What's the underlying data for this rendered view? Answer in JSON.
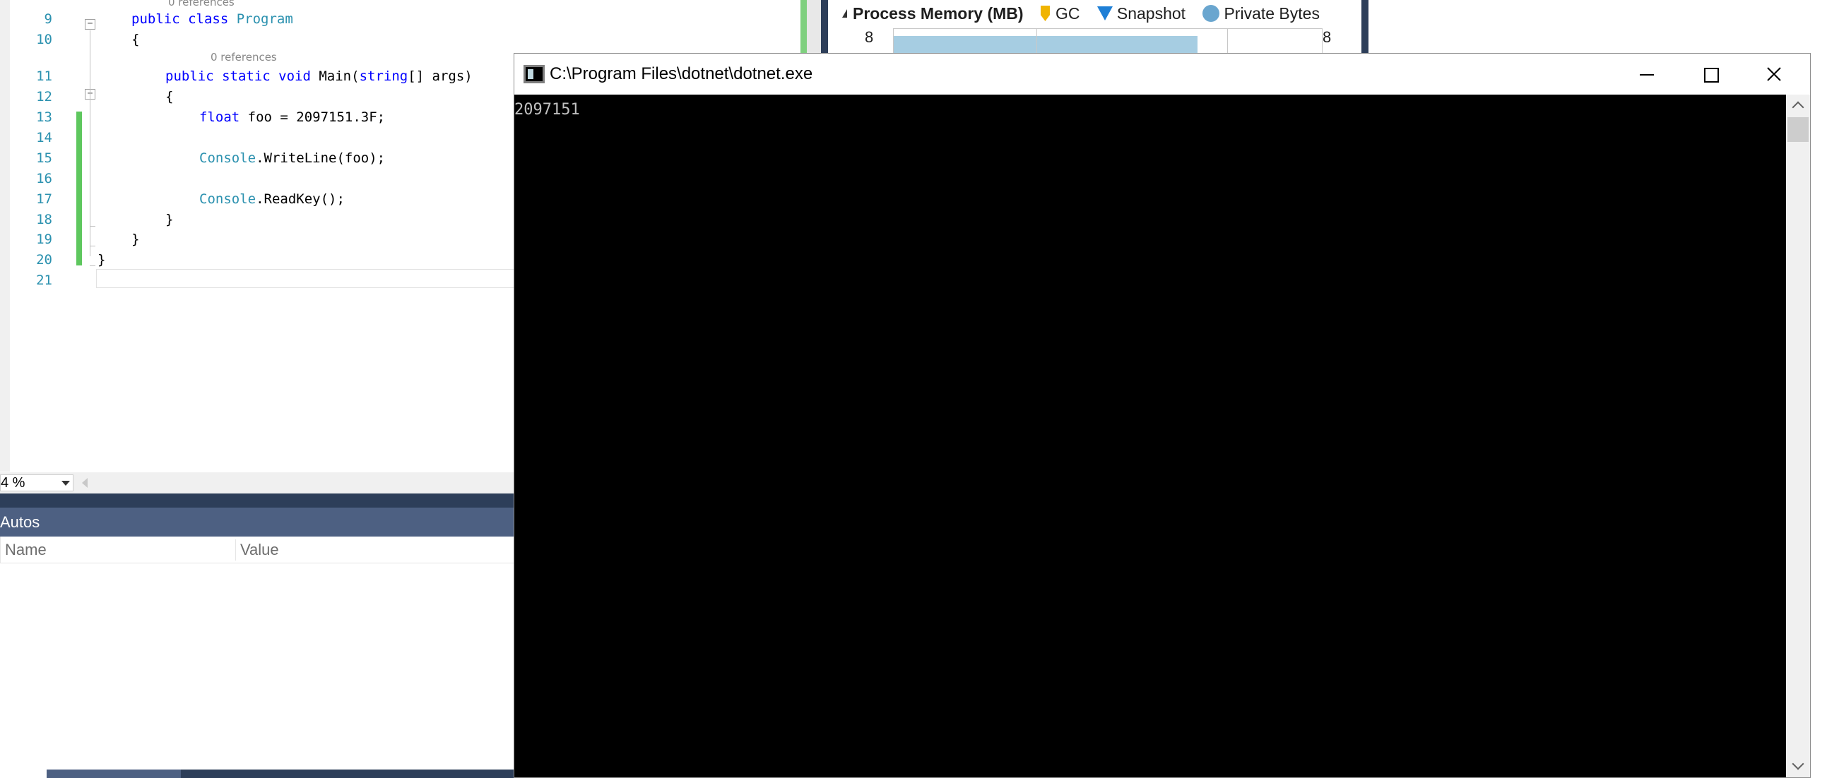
{
  "editor": {
    "code_lens_top": "0 references",
    "code_lens_main": "0 references",
    "lines": [
      {
        "num": "9",
        "tokens": [
          {
            "t": "public ",
            "c": "kw"
          },
          {
            "t": "class ",
            "c": "kw"
          },
          {
            "t": "Program",
            "c": "ty"
          }
        ]
      },
      {
        "num": "10",
        "tokens": [
          {
            "t": "{",
            "c": ""
          }
        ]
      },
      {
        "num": "11",
        "tokens": [
          {
            "t": "public ",
            "c": "kw"
          },
          {
            "t": "static ",
            "c": "kw"
          },
          {
            "t": "void ",
            "c": "kw"
          },
          {
            "t": "Main(",
            "c": ""
          },
          {
            "t": "string",
            "c": "kw"
          },
          {
            "t": "[] args)",
            "c": ""
          }
        ]
      },
      {
        "num": "12",
        "tokens": [
          {
            "t": "{",
            "c": ""
          }
        ]
      },
      {
        "num": "13",
        "tokens": [
          {
            "t": "float ",
            "c": "kw"
          },
          {
            "t": "foo = 2097151.3F;",
            "c": ""
          }
        ]
      },
      {
        "num": "14",
        "tokens": []
      },
      {
        "num": "15",
        "tokens": [
          {
            "t": "Console",
            "c": "ty"
          },
          {
            "t": ".WriteLine(foo);",
            "c": ""
          }
        ]
      },
      {
        "num": "16",
        "tokens": []
      },
      {
        "num": "17",
        "tokens": [
          {
            "t": "Console",
            "c": "ty"
          },
          {
            "t": ".ReadKey();",
            "c": ""
          }
        ]
      },
      {
        "num": "18",
        "tokens": [
          {
            "t": "}",
            "c": ""
          }
        ]
      },
      {
        "num": "19",
        "tokens": [
          {
            "t": "}",
            "c": ""
          }
        ]
      },
      {
        "num": "20",
        "tokens": [
          {
            "t": "}",
            "c": ""
          }
        ]
      },
      {
        "num": "21",
        "tokens": []
      }
    ],
    "zoom_level": "4 %"
  },
  "autos": {
    "title": "Autos",
    "col_name": "Name",
    "col_value": "Value"
  },
  "diagnostics": {
    "title": "Process Memory (MB)",
    "legend_gc": "GC",
    "legend_snapshot": "Snapshot",
    "legend_private_bytes": "Private Bytes",
    "axis_left": "8",
    "axis_right": "8",
    "colors": {
      "gc": "#f0b400",
      "snapshot": "#1e7fd6",
      "private_bytes": "#6aa6cf"
    }
  },
  "console": {
    "title": "C:\\Program Files\\dotnet\\dotnet.exe",
    "output": "2097151",
    "icons": {
      "minimize": "minimize-icon",
      "maximize": "maximize-icon",
      "close": "close-icon"
    }
  }
}
